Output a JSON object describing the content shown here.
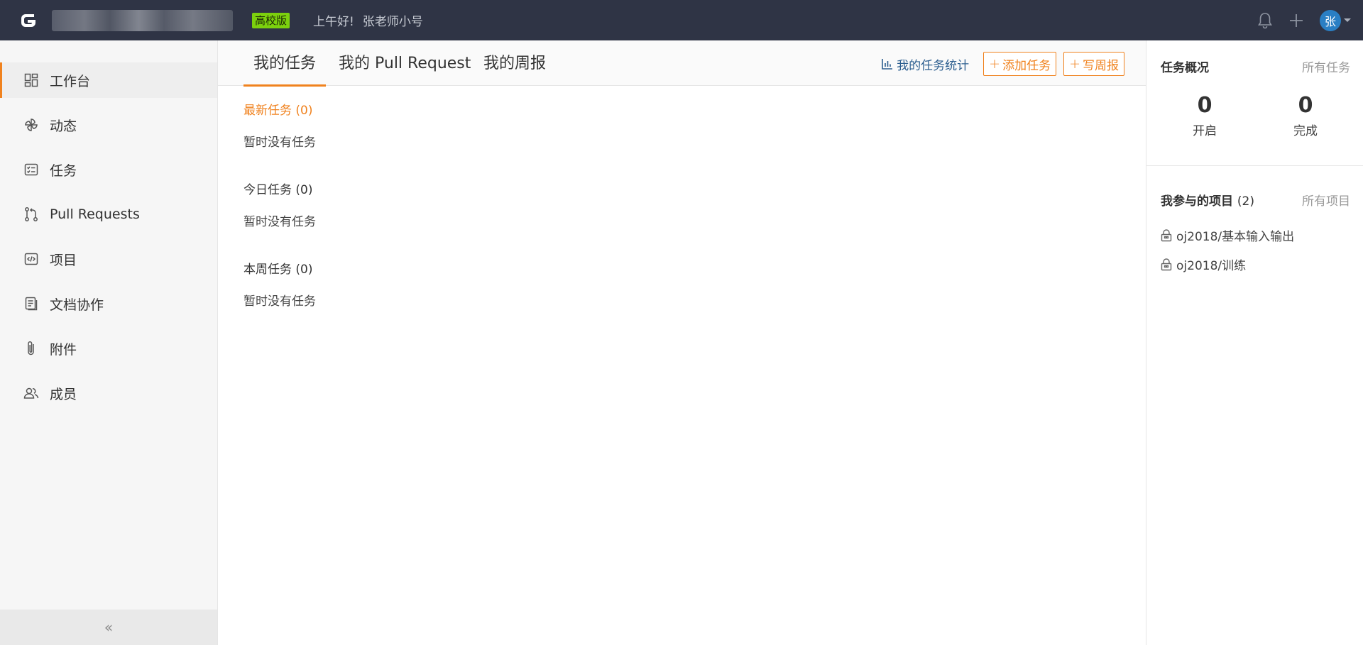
{
  "topbar": {
    "edition": "高校版",
    "greeting": "上午好!",
    "username": "张老师小号",
    "avatar_text": "张",
    "logo_icon": "gitee-logo-icon",
    "bell_icon": "bell-icon",
    "plus_icon": "plus-icon"
  },
  "sidebar": {
    "items": [
      {
        "label": "工作台",
        "icon": "dashboard-icon"
      },
      {
        "label": "动态",
        "icon": "pinwheel-icon"
      },
      {
        "label": "任务",
        "icon": "checklist-icon"
      },
      {
        "label": "Pull Requests",
        "icon": "pull-request-icon"
      },
      {
        "label": "项目",
        "icon": "code-icon"
      },
      {
        "label": "文档协作",
        "icon": "document-icon"
      },
      {
        "label": "附件",
        "icon": "paperclip-icon"
      },
      {
        "label": "成员",
        "icon": "members-icon"
      }
    ],
    "collapse_label": "«"
  },
  "main": {
    "tabs": [
      {
        "label": "我的任务"
      },
      {
        "label": "我的 Pull Request"
      },
      {
        "label": "我的周报"
      }
    ],
    "stat_link": "我的任务统计",
    "add_task": "添加任务",
    "write_report": "写周报",
    "sections": [
      {
        "title": "最新任务 (0)",
        "empty": "暂时没有任务"
      },
      {
        "title": "今日任务 (0)",
        "empty": "暂时没有任务"
      },
      {
        "title": "本周任务 (0)",
        "empty": "暂时没有任务"
      }
    ]
  },
  "right": {
    "overview_title": "任务概况",
    "all_tasks": "所有任务",
    "open_count": "0",
    "open_label": "开启",
    "done_count": "0",
    "done_label": "完成",
    "projects_title": "我参与的项目",
    "projects_count": "(2)",
    "all_projects": "所有项目",
    "projects": [
      "oj2018/基本输入输出",
      "oj2018/训练"
    ]
  },
  "colors": {
    "topbar": "#2f3445",
    "accent": "#f0821e",
    "badge": "#7cd10e",
    "avatar": "#2a7fc4"
  }
}
